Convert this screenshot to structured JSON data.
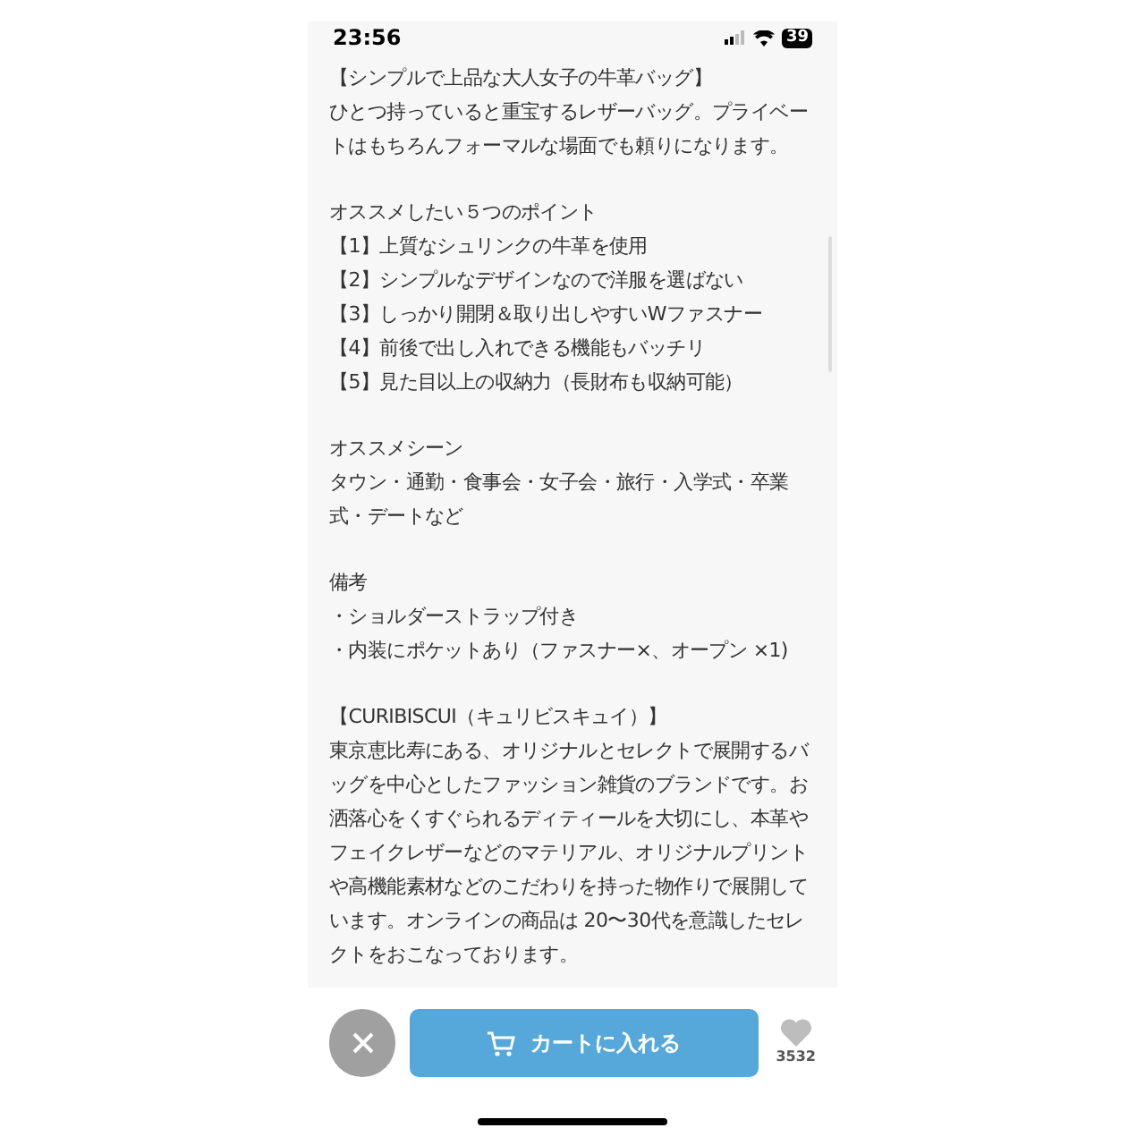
{
  "status_bar": {
    "time": "23:56",
    "battery": "39"
  },
  "sections": [
    {
      "lines": [
        "【シンプルで上品な大人女子の牛革バッグ】",
        "ひとつ持っていると重宝するレザーバッグ。プライベー",
        "トはもちろんフォーマルな場面でも頼りになります。"
      ]
    },
    {
      "lines": [
        "オススメしたい５つのポイント",
        "【1】上質なシュリンクの牛革を使用",
        "【2】シンプルなデザインなので洋服を選ばない",
        "【3】しっかり開閉＆取り出しやすいWファスナー",
        "【4】前後で出し入れできる機能もバッチリ",
        "【5】見た目以上の収納力（長財布も収納可能）"
      ]
    },
    {
      "lines": [
        "オススメシーン",
        "タウン・通勤・食事会・女子会・旅行・入学式・卒業",
        "式・デートなど"
      ]
    },
    {
      "lines": [
        "備考",
        "・ショルダーストラップ付き",
        "・内装にポケットあり（ファスナー×、オープン ×1)"
      ]
    },
    {
      "lines": [
        "【CURIBISCUI（キュリビスキュイ）】",
        "東京恵比寿にある、オリジナルとセレクトで展開するバ",
        "ッグを中心としたファッション雑貨のブランドです。お",
        "洒落心をくすぐられるディティールを大切にし、本革や",
        "フェイクレザーなどのマテリアル、オリジナルプリント",
        "や高機能素材などのこだわりを持った物作りで展開して",
        "います。オンラインの商品は 20〜30代を意識したセレ",
        "クトをおこなっております。"
      ]
    }
  ],
  "bottom_bar": {
    "cart_button": "カートに入れる",
    "like_count": "3532"
  }
}
